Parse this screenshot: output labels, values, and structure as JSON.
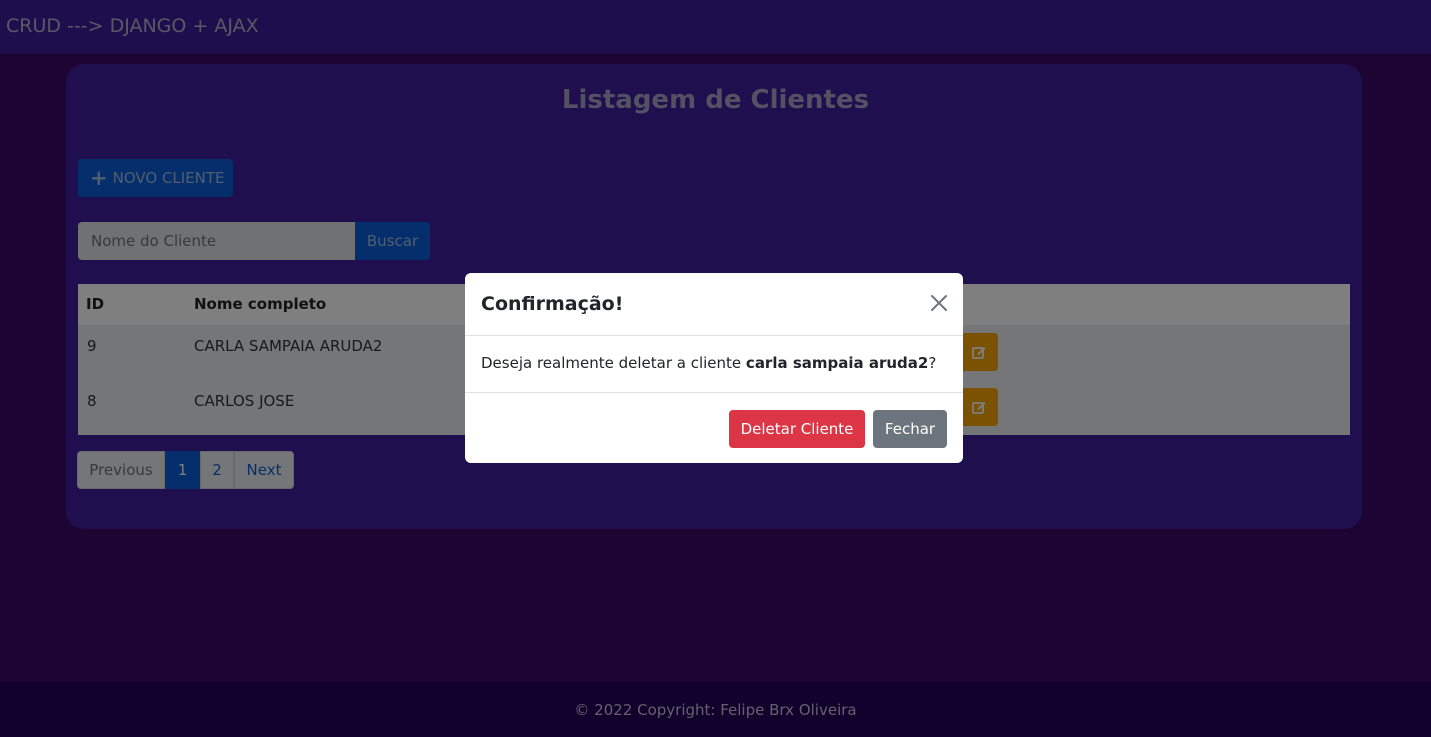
{
  "navbar": {
    "brand": "CRUD ---> DJANGO + AJAX"
  },
  "page": {
    "title": "Listagem de Clientes"
  },
  "toolbar": {
    "new_button_label": "NOVO CLIENTE",
    "new_button_icon": "plus-icon",
    "search_placeholder": "Nome do Cliente",
    "search_button_label": "Buscar"
  },
  "table": {
    "columns": [
      "ID",
      "Nome completo"
    ],
    "rows": [
      {
        "id": "9",
        "name": "CARLA SAMPAIA ARUDA2"
      },
      {
        "id": "8",
        "name": "CARLOS JOSE"
      }
    ]
  },
  "pagination": {
    "previous": "Previous",
    "pages": [
      "1",
      "2"
    ],
    "active_page": "1",
    "next": "Next"
  },
  "footer": {
    "copyright": "© 2022 Copyright: Felipe Brx Oliveira"
  },
  "modal": {
    "title": "Confirmação!",
    "message_prefix": "Deseja realmente deletar a cliente ",
    "client_name": "carla sampaia aruda2",
    "message_suffix": "?",
    "delete_label": "Deletar Cliente",
    "close_label": "Fechar"
  },
  "colors": {
    "navbar": "#3e1c9c",
    "card": "#3f1e9e",
    "primary": "#0b5fd8",
    "warning": "#f6a405",
    "danger": "#dc3545",
    "secondary": "#6c757d"
  }
}
